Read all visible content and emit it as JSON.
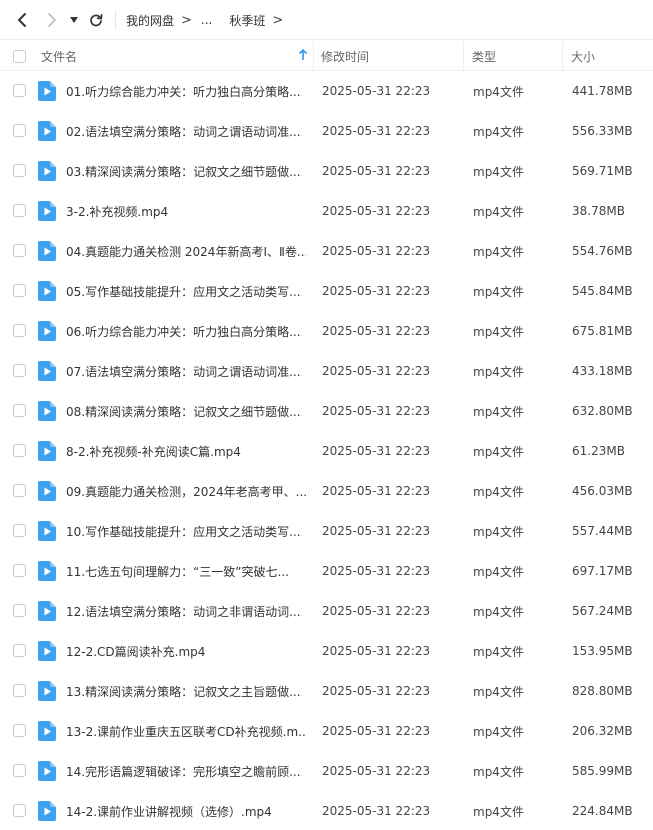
{
  "toolbar": {
    "breadcrumb": [
      "我的网盘",
      "...",
      "秋季班"
    ],
    "icons": [
      "back-arrow-icon",
      "forward-arrow-icon",
      "dropdown-triangle-icon",
      "refresh-icon"
    ]
  },
  "columns": {
    "name": "文件名",
    "modified": "修改时间",
    "type": "类型",
    "size": "大小"
  },
  "colors": {
    "accent": "#2b98f0",
    "file_icon": "#3da2f2"
  },
  "files": [
    {
      "name": "01.听力综合能力冲关：听力独白高分策略...",
      "modified": "2025-05-31 22:23",
      "type": "mp4文件",
      "size": "441.78MB"
    },
    {
      "name": "02.语法填空满分策略：动词之谓语动词准...",
      "modified": "2025-05-31 22:23",
      "type": "mp4文件",
      "size": "556.33MB"
    },
    {
      "name": "03.精深阅读满分策略：记叙文之细节题做...",
      "modified": "2025-05-31 22:23",
      "type": "mp4文件",
      "size": "569.71MB"
    },
    {
      "name": "3-2.补充视频.mp4",
      "modified": "2025-05-31 22:23",
      "type": "mp4文件",
      "size": "38.78MB"
    },
    {
      "name": "04.真题能力通关检测 2024年新高考Ⅰ、Ⅱ卷...",
      "modified": "2025-05-31 22:23",
      "type": "mp4文件",
      "size": "554.76MB"
    },
    {
      "name": "05.写作基础技能提升：应用文之活动类写...",
      "modified": "2025-05-31 22:23",
      "type": "mp4文件",
      "size": "545.84MB"
    },
    {
      "name": "06.听力综合能力冲关：听力独白高分策略...",
      "modified": "2025-05-31 22:23",
      "type": "mp4文件",
      "size": "675.81MB"
    },
    {
      "name": "07.语法填空满分策略：动词之谓语动词准...",
      "modified": "2025-05-31 22:23",
      "type": "mp4文件",
      "size": "433.18MB"
    },
    {
      "name": "08.精深阅读满分策略：记叙文之细节题做...",
      "modified": "2025-05-31 22:23",
      "type": "mp4文件",
      "size": "632.80MB"
    },
    {
      "name": "8-2.补充视频-补充阅读C篇.mp4",
      "modified": "2025-05-31 22:23",
      "type": "mp4文件",
      "size": "61.23MB"
    },
    {
      "name": "09.真题能力通关检测，2024年老高考甲、...",
      "modified": "2025-05-31 22:23",
      "type": "mp4文件",
      "size": "456.03MB"
    },
    {
      "name": "10.写作基础技能提升：应用文之活动类写...",
      "modified": "2025-05-31 22:23",
      "type": "mp4文件",
      "size": "557.44MB"
    },
    {
      "name": "11.七选五句间理解力：“三一致”突破七...",
      "modified": "2025-05-31 22:23",
      "type": "mp4文件",
      "size": "697.17MB"
    },
    {
      "name": "12.语法填空满分策略：动词之非谓语动词...",
      "modified": "2025-05-31 22:23",
      "type": "mp4文件",
      "size": "567.24MB"
    },
    {
      "name": "12-2.CD篇阅读补充.mp4",
      "modified": "2025-05-31 22:23",
      "type": "mp4文件",
      "size": "153.95MB"
    },
    {
      "name": "13.精深阅读满分策略：记叙文之主旨题做...",
      "modified": "2025-05-31 22:23",
      "type": "mp4文件",
      "size": "828.80MB"
    },
    {
      "name": "13-2.课前作业重庆五区联考CD补充视频.m...",
      "modified": "2025-05-31 22:23",
      "type": "mp4文件",
      "size": "206.32MB"
    },
    {
      "name": "14.完形语篇逻辑破译：完形填空之瞻前顾...",
      "modified": "2025-05-31 22:23",
      "type": "mp4文件",
      "size": "585.99MB"
    },
    {
      "name": "14-2.课前作业讲解视频（选修）.mp4",
      "modified": "2025-05-31 22:23",
      "type": "mp4文件",
      "size": "224.84MB"
    }
  ]
}
